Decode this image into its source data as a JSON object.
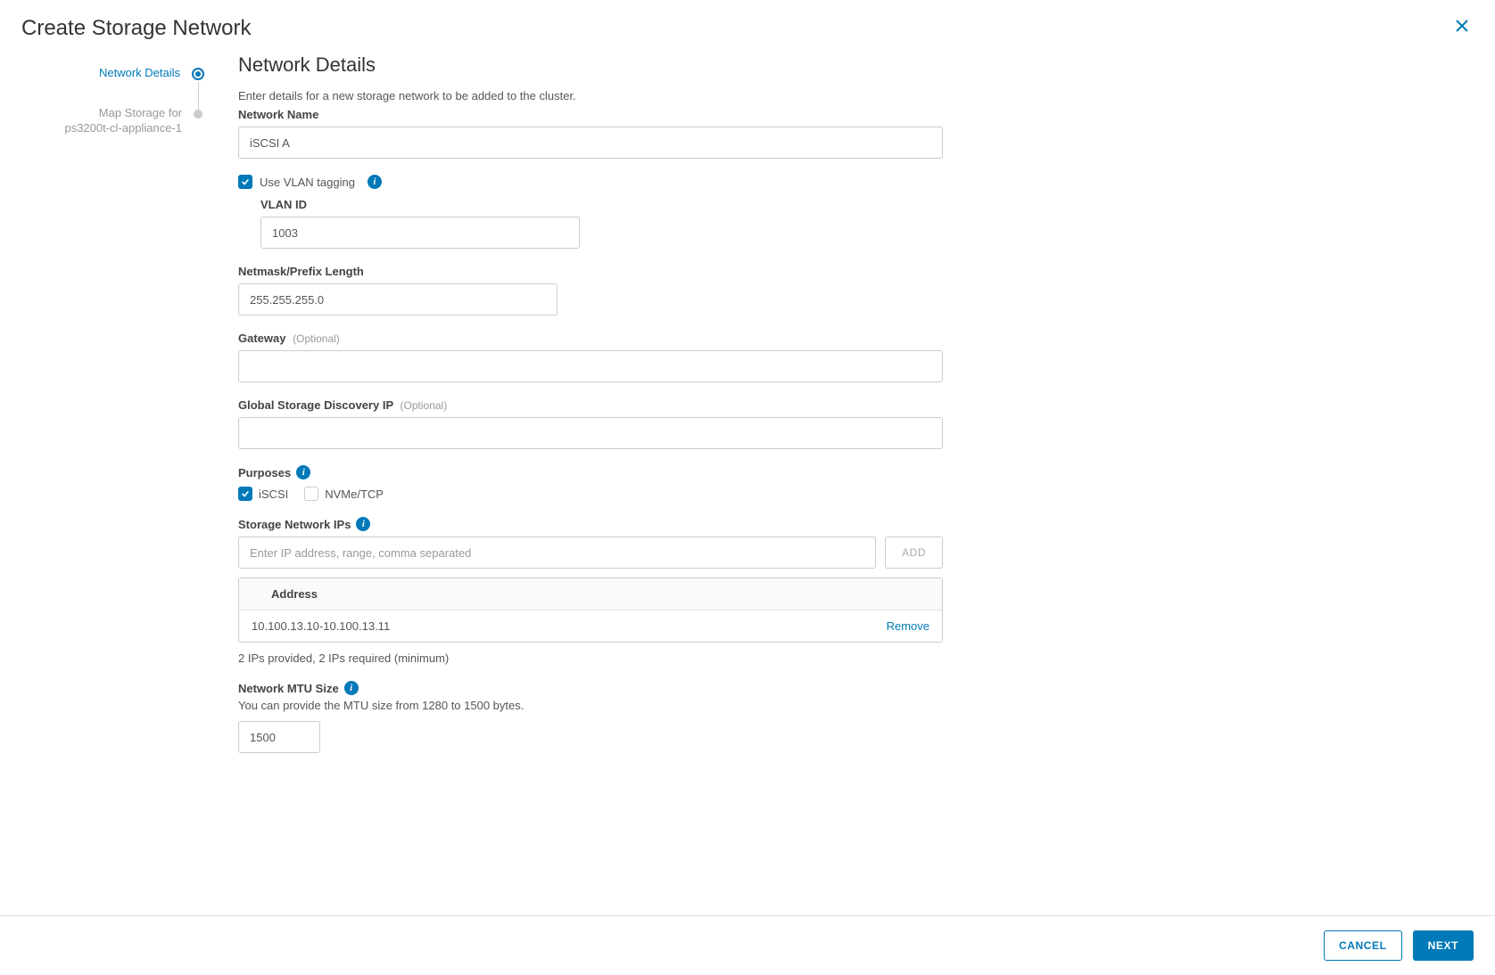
{
  "modal": {
    "title": "Create Storage Network"
  },
  "stepper": {
    "step1": "Network Details",
    "step2": "Map Storage for ps3200t-cl-appliance-1"
  },
  "form": {
    "section_title": "Network Details",
    "description": "Enter details for a new storage network to be added to the cluster.",
    "network_name_label": "Network Name",
    "network_name_value": "iSCSI A",
    "vlan_tagging_label": "Use VLAN tagging",
    "vlan_id_label": "VLAN ID",
    "vlan_id_value": "1003",
    "netmask_label": "Netmask/Prefix Length",
    "netmask_value": "255.255.255.0",
    "gateway_label": "Gateway",
    "gateway_optional": "(Optional)",
    "gateway_value": "",
    "discovery_label": "Global Storage Discovery IP",
    "discovery_optional": "(Optional)",
    "discovery_value": "",
    "purposes_label": "Purposes",
    "purpose_iscsi": "iSCSI",
    "purpose_nvme": "NVMe/TCP",
    "storage_ips_label": "Storage Network IPs",
    "ip_placeholder": "Enter IP address, range, comma separated",
    "add_btn": "ADD",
    "address_header": "Address",
    "ip_row_value": "10.100.13.10-10.100.13.11",
    "remove_link": "Remove",
    "ip_hint": "2 IPs provided, 2 IPs required (minimum)",
    "mtu_label": "Network MTU Size",
    "mtu_desc": "You can provide the MTU size from 1280 to 1500 bytes.",
    "mtu_value": "1500"
  },
  "footer": {
    "cancel": "CANCEL",
    "next": "NEXT"
  }
}
